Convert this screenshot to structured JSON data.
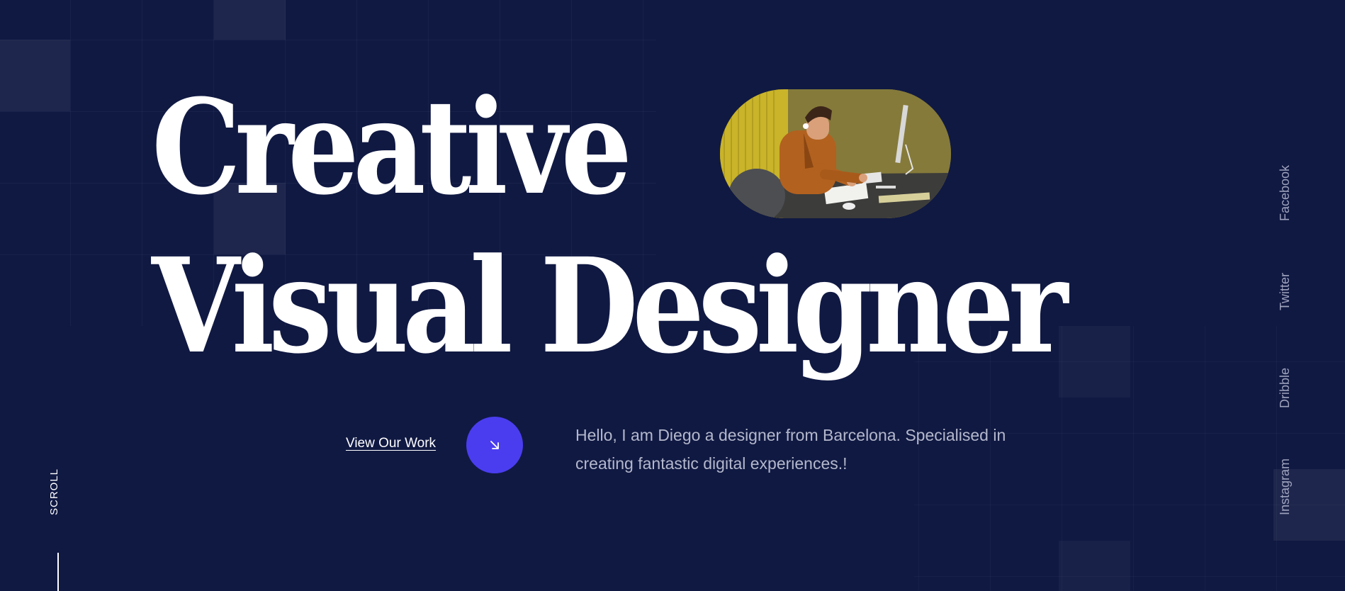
{
  "hero": {
    "line1": "Creative",
    "line2": "Visual Designer",
    "photo_alt": "Designer working at desk"
  },
  "cta": {
    "link_label": "View Our Work",
    "arrow_icon": "arrow-down-right-icon"
  },
  "intro": {
    "text": "Hello, I am Diego a designer from Barcelona. Specialised in creating fantastic digital experiences.!"
  },
  "scroll": {
    "label": "SCROLL"
  },
  "social": {
    "items": [
      {
        "label": "Facebook"
      },
      {
        "label": "Twitter"
      },
      {
        "label": "Dribble"
      },
      {
        "label": "Instagram"
      }
    ]
  },
  "colors": {
    "background": "#101942",
    "accent": "#4a3df0",
    "text": "#ffffff",
    "muted_text": "#b4b8cc"
  }
}
